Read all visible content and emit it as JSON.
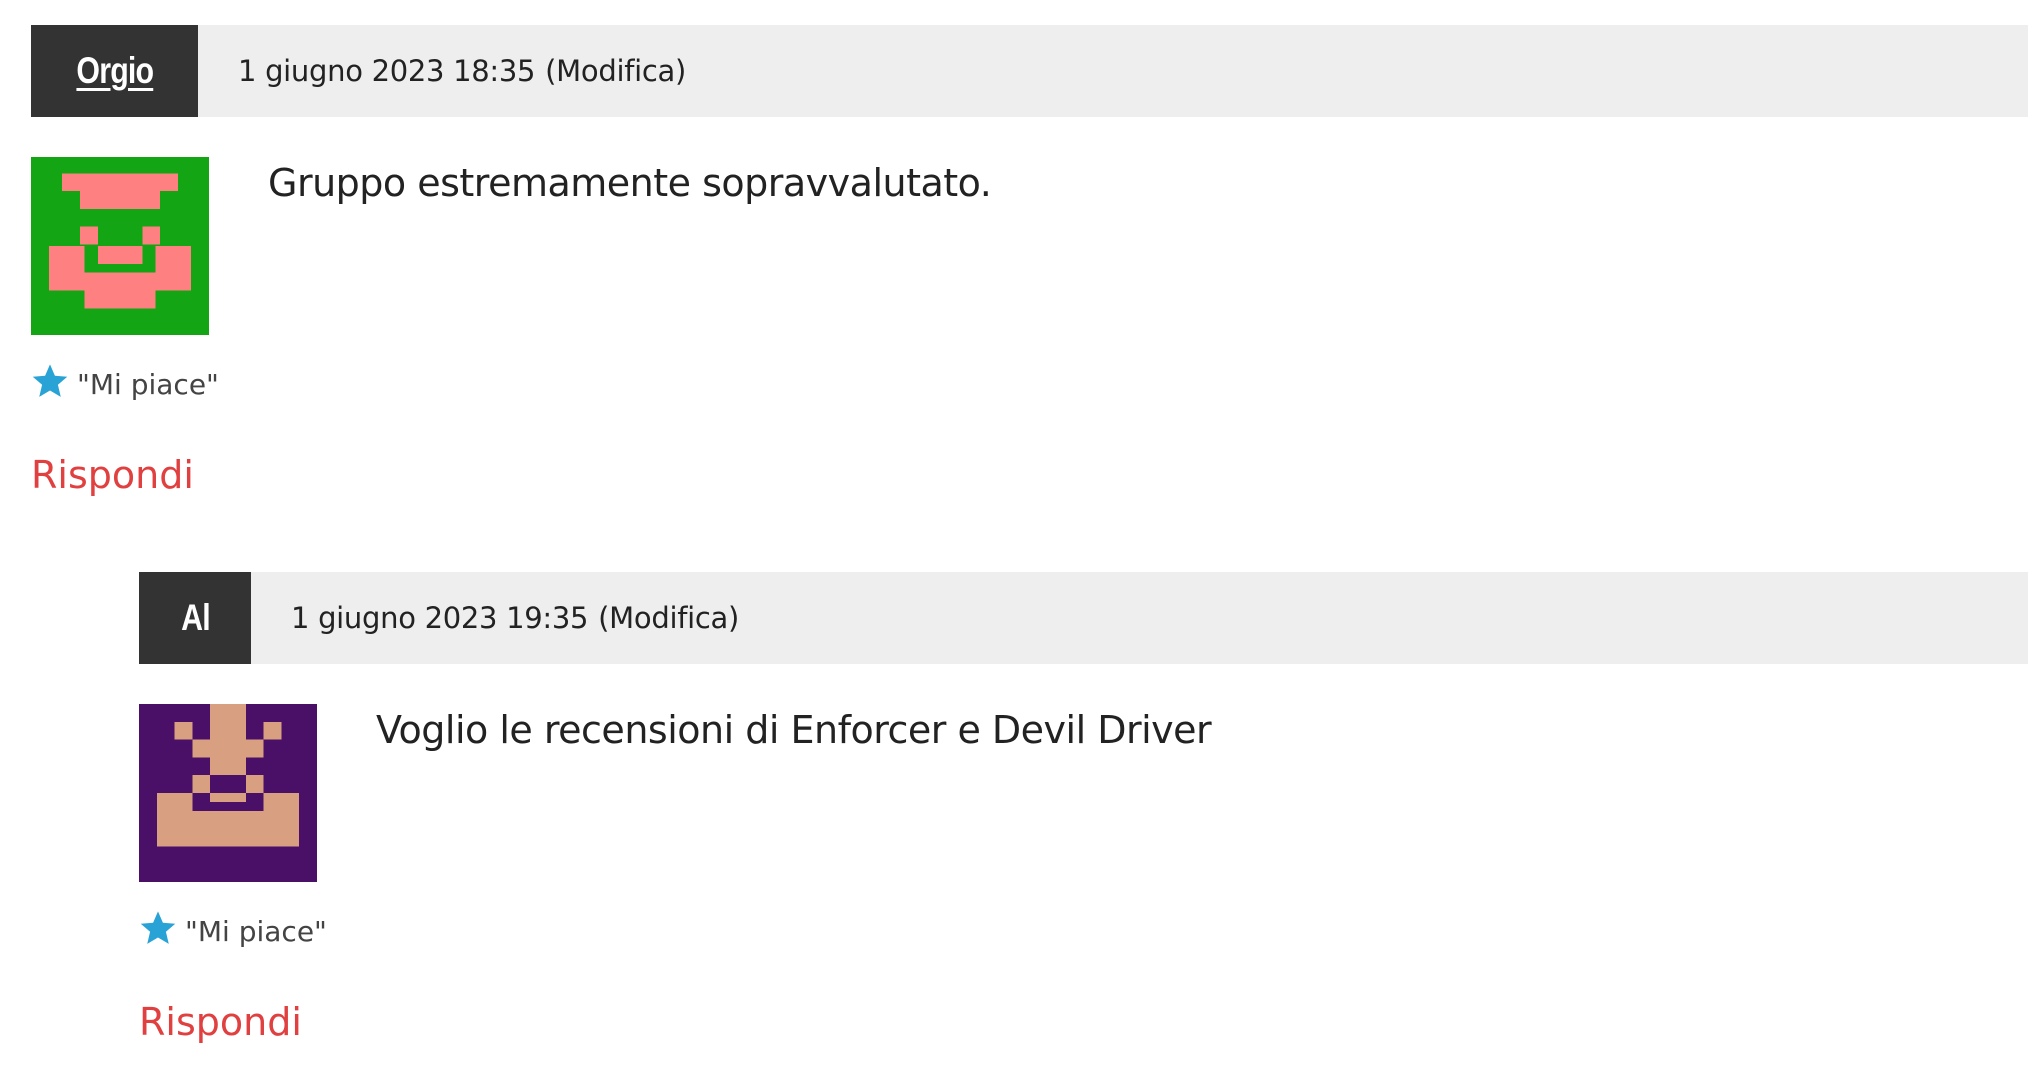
{
  "comments": [
    {
      "author": "Orgio",
      "author_is_link": true,
      "date": "1 giugno 2023 18:35",
      "edit_label": "(Modifica)",
      "text": "Gruppo estremamente sopravvalutato.",
      "avatar": {
        "background": "#14a514",
        "foreground": "#ff8080",
        "icon": "identicon-avatar"
      },
      "like_label": "\"Mi piace\"",
      "reply_label": "Rispondi"
    },
    {
      "author": "Al",
      "author_is_link": false,
      "date": "1 giugno 2023 19:35",
      "edit_label": "(Modifica)",
      "text": "Voglio le recensioni di Enforcer e Devil Driver",
      "avatar": {
        "background": "#4a0f66",
        "foreground": "#d8a080",
        "icon": "identicon-avatar"
      },
      "like_label": "\"Mi piace\"",
      "reply_label": "Rispondi"
    }
  ],
  "colors": {
    "author_bg": "#333333",
    "meta_bg": "#eeeeee",
    "star": "#29a3d6",
    "reply": "#e04040"
  }
}
